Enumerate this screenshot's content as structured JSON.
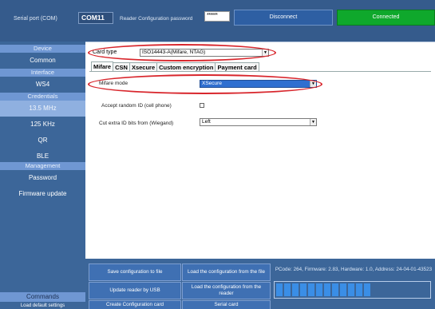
{
  "topbar": {
    "serial_label": "Serial port (COM)",
    "com_value": "COM11",
    "password_label": "Reader Configuration password",
    "password_value": "******",
    "disconnect_label": "Disconnect",
    "status_label": "Connected"
  },
  "sidebar": {
    "items": [
      {
        "label": "Device",
        "kind": "header"
      },
      {
        "label": "Common",
        "kind": "link"
      },
      {
        "label": "Interface",
        "kind": "header"
      },
      {
        "label": "WS4",
        "kind": "link"
      },
      {
        "label": "Credentials",
        "kind": "header"
      },
      {
        "label": "13.5 MHz",
        "kind": "link",
        "selected": true
      },
      {
        "label": "125 KHz",
        "kind": "link"
      },
      {
        "label": "QR",
        "kind": "link"
      },
      {
        "label": "BLE",
        "kind": "link"
      },
      {
        "label": "Management",
        "kind": "header"
      },
      {
        "label": "Password",
        "kind": "link"
      },
      {
        "label": "Firmware update",
        "kind": "link"
      }
    ],
    "commands_label": "Commands",
    "bottom_text": "Load default settings"
  },
  "main": {
    "card_type_label": "Card type",
    "card_type_value": "ISO14443-A(Mifare, NTAG)",
    "tabs": [
      {
        "label": "Mifare",
        "active": true
      },
      {
        "label": "CSN"
      },
      {
        "label": "Xsecure"
      },
      {
        "label": "Custom encryption"
      },
      {
        "label": "Payment card"
      }
    ],
    "mifare_mode_label": "Mifare mode",
    "mifare_mode_value": "XSecure",
    "accept_random_label": "Accept random ID (cell phone)",
    "cut_bits_label": "Cut extra ID bits from (Wiegand)",
    "cut_bits_value": "Left",
    "dropdown_arrow": "▼"
  },
  "commands": {
    "save_file": "Save configuration to file",
    "load_file": "Load the configuration from the file",
    "update_usb": "Update reader by USB",
    "load_reader": "Load the configuration from the reader",
    "create_card": "Create Configuration card",
    "serial_card": "Serial card"
  },
  "info": {
    "pcode_text": "PCode: 264, Firmware: 2.83, Hardware: 1.0, Address: 24-04-01-43523"
  },
  "progress": {
    "filled_cells": 12
  },
  "colors": {
    "nav_bg": "#3c6699",
    "topbar_bg": "#355b8c",
    "connected_green": "#0fa82c",
    "highlight_red": "#d8262c"
  }
}
